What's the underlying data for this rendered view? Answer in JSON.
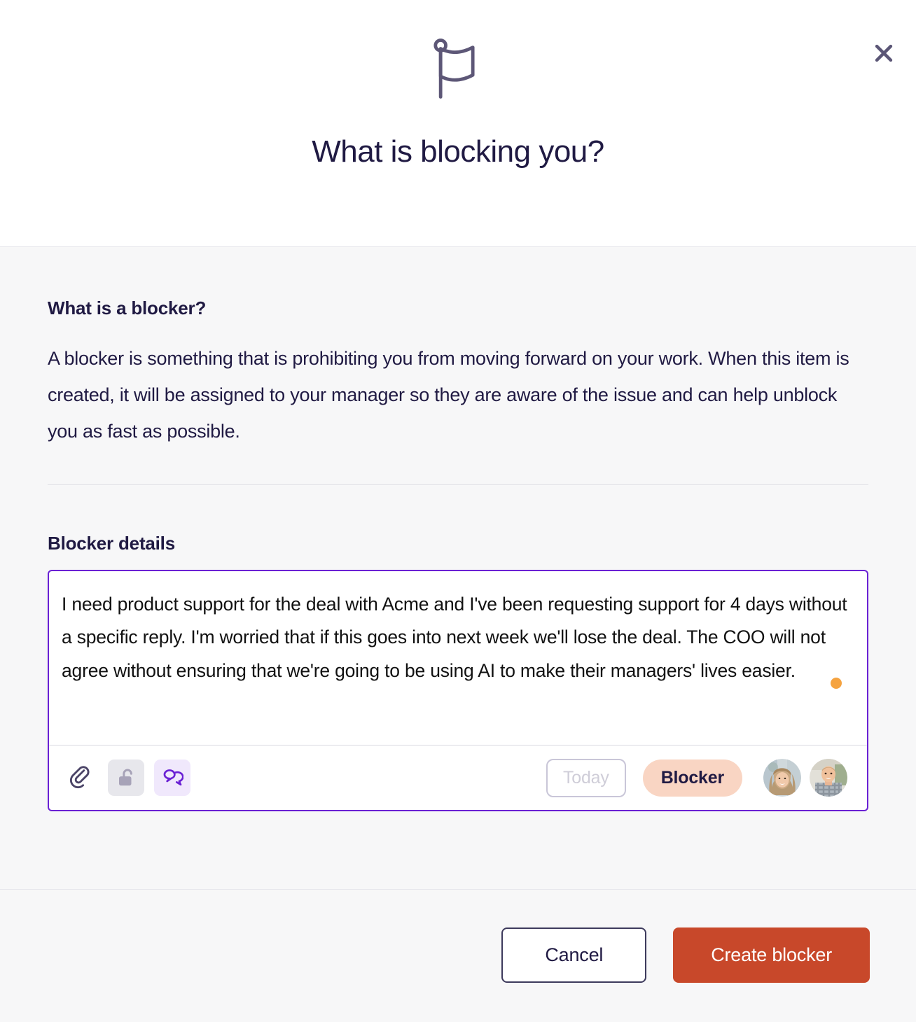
{
  "header": {
    "icon": "flag-icon",
    "title": "What is blocking you?",
    "close_label": "close-icon"
  },
  "body": {
    "section_heading": "What is a blocker?",
    "section_paragraph": "A blocker is something that is prohibiting you from moving forward on your work. When this item is created, it will be assigned to your manager so they are aware of the issue and can help unblock you as fast as possible.",
    "details_label": "Blocker details"
  },
  "editor": {
    "value": "I need product support for the deal with Acme and I've been requesting support for 4 days without a specific reply. I'm worried that if this goes into next week we'll lose the deal. The COO will not agree without ensuring that we're going to be using AI to make their managers' lives easier.",
    "status_dot_color": "#f5a340",
    "toolbar": {
      "attachment_icon": "paperclip-icon",
      "privacy_icon": "unlocked-padlock-icon",
      "comment_icon": "speech-bubbles-icon",
      "date_label": "Today",
      "type_label": "Blocker",
      "assignees": [
        {
          "name": "avatar-woman"
        },
        {
          "name": "avatar-man"
        }
      ]
    }
  },
  "footer": {
    "cancel_label": "Cancel",
    "create_label": "Create blocker"
  },
  "colors": {
    "accent_purple": "#6a21d4",
    "primary_button": "#c8482a",
    "pill_peach": "#f9d5c3",
    "navy": "#201a43"
  }
}
